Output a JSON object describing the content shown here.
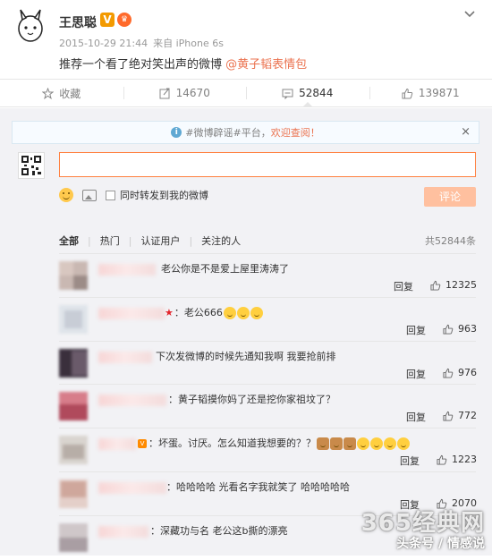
{
  "post": {
    "author": "王思聪",
    "verified_badge": "V",
    "meta_time": "2015-10-29 21:44",
    "meta_from": "来自 iPhone 6s",
    "text": "推荐一个看了绝对笑出声的微博 ",
    "mention": "@黄子韬表情包"
  },
  "actions": [
    {
      "icon": "star-icon",
      "label": "收藏"
    },
    {
      "icon": "repost-icon",
      "label": "14670"
    },
    {
      "icon": "comment-icon",
      "label": "52844"
    },
    {
      "icon": "like-icon",
      "label": "139871"
    }
  ],
  "notice": {
    "text": "#微博辟谣#平台，",
    "link": "欢迎查阅！",
    "close": "×"
  },
  "composer": {
    "input_value": "",
    "placeholder": "",
    "sync_label": "同时转发到我的微博",
    "submit_label": "评论"
  },
  "filters": {
    "items": [
      "全部",
      "热门",
      "认证用户",
      "关注的人"
    ],
    "total": "共52844条"
  },
  "comments": [
    {
      "text": "老公你是不是爱上屋里涛涛了",
      "reply": "回复",
      "likes": "12325"
    },
    {
      "text": "：老公666",
      "reply": "回复",
      "likes": "963"
    },
    {
      "text": "下次发微博的时候先通知我啊 我要抢前排",
      "reply": "回复",
      "likes": "976"
    },
    {
      "text": "：黄子韬摸你妈了还是挖你家祖坟了？",
      "reply": "回复",
      "likes": "772"
    },
    {
      "text": "：坏蛋。讨厌。怎么知道我想要的？？",
      "reply": "回复",
      "likes": "1223"
    },
    {
      "text": "：哈哈哈哈 光看名字我就笑了 哈哈哈哈哈",
      "reply": "回复",
      "likes": "2070"
    },
    {
      "text": "：深藏功与名 老公这b撕的漂亮",
      "reply": "",
      "likes": ""
    }
  ],
  "watermark": {
    "site": "365经典网",
    "source": "头条号 / 情感说"
  },
  "colors": {
    "accent": "#eb7350",
    "input_border": "#ff8140",
    "submit_disabled": "#ffc09f",
    "panel_bg": "#f2f2f5"
  }
}
